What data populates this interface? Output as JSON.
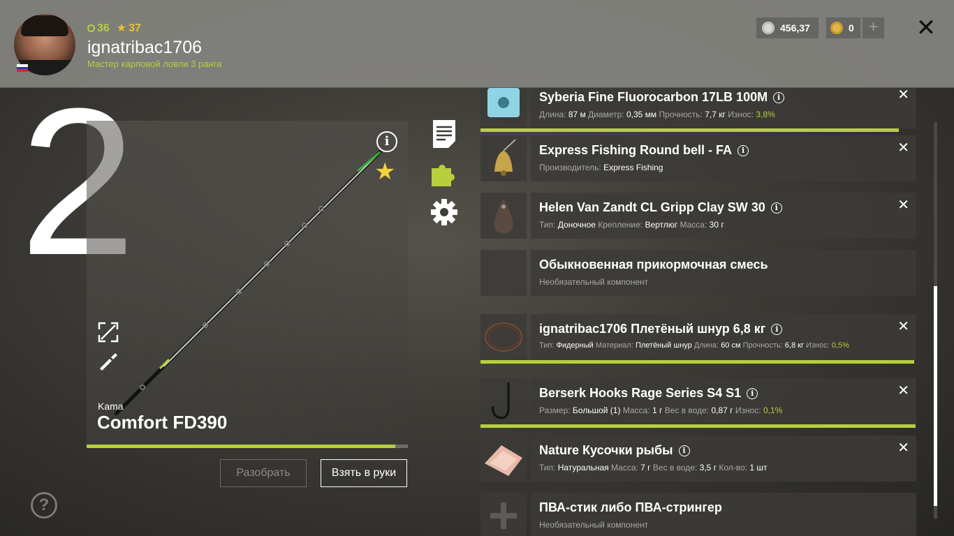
{
  "header": {
    "level": "36",
    "rank_level": "37",
    "username": "ignatribac1706",
    "rank_title": "Мастер карповой ловли 3 ранга",
    "silver": "456,37",
    "gold": "0",
    "plus": "+",
    "close": "✕",
    "flag_colors": [
      "#ffffff",
      "#1c3fb5",
      "#d52b1e"
    ]
  },
  "slot": {
    "number": "2"
  },
  "rod": {
    "brand": "Kama",
    "name": "Comfort FD390",
    "wear_fill": 0.96,
    "info_glyph": "i",
    "favorite_glyph": "★"
  },
  "buttons": {
    "disassemble": "Разобрать",
    "take": "Взять в руки"
  },
  "help": "?",
  "colors": {
    "accent": "#b8cf3c",
    "star": "#f1d23a",
    "panel": "#3c3b37"
  },
  "items": [
    {
      "title": "Syberia Fine Fluorocarbon 17LB 100M",
      "has_info": true,
      "removable": true,
      "wear_fill": 0.96,
      "props": [
        {
          "label": "Длина:",
          "value": "87 м"
        },
        {
          "label": "Диаметр:",
          "value": "0,35 мм"
        },
        {
          "label": "Прочность:",
          "value": "7,7 кг"
        },
        {
          "label": "Износ:",
          "value": "3,8%",
          "green": true
        }
      ]
    },
    {
      "title": "Express Fishing Round bell - FA",
      "has_info": true,
      "removable": true,
      "props": [
        {
          "label": "Производитель:",
          "value": "Express Fishing"
        }
      ]
    },
    {
      "title": "Helen Van Zandt CL Gripp Clay SW 30",
      "has_info": true,
      "removable": true,
      "props": [
        {
          "label": "Тип:",
          "value": "Доночное"
        },
        {
          "label": "Крепление:",
          "value": "Вертлюг"
        },
        {
          "label": "Масса:",
          "value": "30 г"
        }
      ]
    },
    {
      "title": "Обыкновенная прикормочная смесь",
      "has_info": false,
      "removable": false,
      "props": [
        {
          "label": "Необязательный компонент",
          "value": ""
        }
      ]
    },
    {
      "title": "ignatribac1706 Плетёный шнур 6,8 кг",
      "has_info": true,
      "removable": true,
      "wear_fill": 0.995,
      "small": true,
      "props": [
        {
          "label": "Тип:",
          "value": "Фидерный"
        },
        {
          "label": "Материал:",
          "value": "Плетёный шнур"
        },
        {
          "label": "Длина:",
          "value": "60 см"
        },
        {
          "label": "Прочность:",
          "value": "6,8 кг"
        },
        {
          "label": "Износ:",
          "value": "0,5%",
          "green": true
        }
      ]
    },
    {
      "title": "Berserk Hooks Rage Series S4 S1",
      "has_info": true,
      "removable": true,
      "wear_fill": 0.999,
      "props": [
        {
          "label": "Размер:",
          "value": "Большой (1)"
        },
        {
          "label": "Масса:",
          "value": "1 г"
        },
        {
          "label": "Вес в воде:",
          "value": "0,87 г"
        },
        {
          "label": "Износ:",
          "value": "0,1%",
          "green": true
        }
      ]
    },
    {
      "title": "Nature Кусочки рыбы",
      "has_info": true,
      "removable": true,
      "props": [
        {
          "label": "Тип:",
          "value": "Натуральная"
        },
        {
          "label": "Масса:",
          "value": "7 г"
        },
        {
          "label": "Вес в воде:",
          "value": "3,5 г"
        },
        {
          "label": "Кол-во:",
          "value": "1 шт"
        }
      ]
    },
    {
      "title": "ПВА-стик либо ПВА-стрингер",
      "has_info": false,
      "removable": false,
      "props": [
        {
          "label": "Необязательный компонент",
          "value": ""
        }
      ]
    }
  ]
}
